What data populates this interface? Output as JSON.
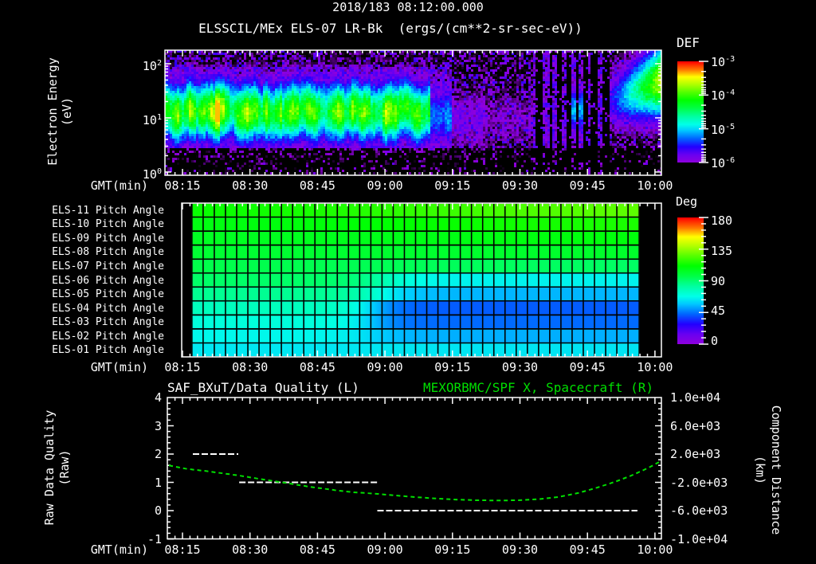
{
  "header": {
    "datetime": "2018/183 08:12:00.000",
    "instrument_title": "ELSSCIL/MEx ELS-07 LR-Bk  (ergs/(cm**2-sr-sec-eV))"
  },
  "time_axis": {
    "label": "GMT(min)",
    "tick_labels": [
      "08:15",
      "08:30",
      "08:45",
      "09:00",
      "09:15",
      "09:30",
      "09:45",
      "10:00"
    ],
    "start_time": "08:12",
    "minutes_per_major_tick": 15,
    "minor_ticks_per_major": 9
  },
  "colors": {
    "background": "#000000",
    "foreground": "#ffffff",
    "series_green": "#00df00",
    "rainbow_stops": [
      [
        0.0,
        "#9000dc"
      ],
      [
        0.08,
        "#6a00f0"
      ],
      [
        0.16,
        "#2200ff"
      ],
      [
        0.24,
        "#0064ff"
      ],
      [
        0.32,
        "#00c8ff"
      ],
      [
        0.38,
        "#00ffe8"
      ],
      [
        0.46,
        "#00ffa0"
      ],
      [
        0.54,
        "#00ff46"
      ],
      [
        0.62,
        "#00ff00"
      ],
      [
        0.7,
        "#55ff00"
      ],
      [
        0.78,
        "#b4ff00"
      ],
      [
        0.85,
        "#ffff00"
      ],
      [
        0.92,
        "#ff7800"
      ],
      [
        1.0,
        "#ff0000"
      ]
    ]
  },
  "panels": {
    "spectrogram": {
      "ylabel_line1": "Electron Energy",
      "ylabel_line2": "(eV)",
      "y_tick_exponents": [
        2,
        1,
        0
      ],
      "colorbar_title": "DEF",
      "colorbar_tick_exponents": [
        -3,
        -4,
        -5,
        -6
      ]
    },
    "pitch": {
      "colorbar_title": "Deg",
      "colorbar_ticks": [
        "180",
        "135",
        "90",
        "45",
        "0"
      ]
    },
    "quality": {
      "title_left": "SAF_BXuT/Data Quality (L)",
      "title_right": "MEXORBMC/SPF X, Spacecraft (R)",
      "ylabel_line1": "Raw Data Quality",
      "ylabel_line2": "(Raw)",
      "ylabel_right_line1": "Component Distance",
      "ylabel_right_line2": "(km)",
      "y_left_ticks": [
        "4",
        "3",
        "2",
        "1",
        "0",
        "-1"
      ],
      "y_right_ticks": [
        "1.0e+04",
        "6.0e+03",
        "2.0e+03",
        "-2.0e+03",
        "-6.0e+03",
        "-1.0e+04"
      ]
    }
  },
  "chart_data": [
    {
      "type": "heatmap",
      "name": "electron_energy_spectrogram",
      "title": "ELSSCIL/MEx ELS-07 LR-Bk (ergs/(cm**2-sr-sec-eV))",
      "start": "2018/183 08:12:00.000",
      "xlabel": "GMT(min)",
      "x_ticks": [
        "08:15",
        "08:30",
        "08:45",
        "09:00",
        "09:15",
        "09:30",
        "09:45",
        "10:00"
      ],
      "ylabel": "Electron Energy (eV)",
      "y_scale": "log",
      "y_range_ev": [
        0.9,
        178
      ],
      "colorbar": {
        "title": "DEF",
        "units": "ergs/(cm**2-sr-sec-eV)",
        "log10_range": [
          -6,
          -3
        ]
      },
      "features": [
        {
          "name": "background_speckle",
          "log10_flux_range": [
            -6.5,
            -5.55
          ]
        },
        {
          "name": "enhanced_striated_band",
          "t_min": [
            0,
            58
          ],
          "log10_e_center": 1.02,
          "log10_e_sigma": 0.38,
          "peak_log10_flux": -3.9,
          "brighter_before_min": 25
        },
        {
          "name": "weakening_band",
          "t_min": [
            58,
            63
          ],
          "peak_log10_flux": -4.9
        },
        {
          "name": "faint_interval",
          "t_min": [
            63,
            81
          ],
          "peak_log10_flux": -5.6,
          "log10_e_center": 0.95
        },
        {
          "name": "dropout_interval",
          "t_min": [
            81,
            98
          ],
          "dropout_fraction": 0.55,
          "cyan_patch": {
            "t_min": [
              89,
              93
            ],
            "log10_e_center": 1.15,
            "peak_log10_flux": -5.1
          }
        },
        {
          "name": "recovery_blob",
          "t_min": [
            98,
            110.5
          ],
          "log10_e_center_start": 1.3,
          "log10_e_center_end": 1.72,
          "peak_log10_flux_end": -3.4
        }
      ]
    },
    {
      "type": "heatmap",
      "name": "pitch_angles",
      "units": "deg",
      "data_window": {
        "start": "08:17",
        "end": "09:56",
        "start_min": 5.1,
        "end_min": 104.5
      },
      "grid_columns": 40,
      "colorbar": {
        "title": "Deg",
        "range": [
          0,
          180
        ]
      },
      "rows": [
        {
          "label": "ELS-11 Pitch Angle",
          "deg_start": 111,
          "deg_end": 129,
          "transition_center_min": 55,
          "transition_width_min": 90
        },
        {
          "label": "ELS-10 Pitch Angle",
          "deg_start": 107,
          "deg_end": 117,
          "transition_center_min": 55,
          "transition_width_min": 90
        },
        {
          "label": "ELS-09 Pitch Angle",
          "deg_start": 104,
          "deg_end": 110,
          "transition_center_min": 55,
          "transition_width_min": 90
        },
        {
          "label": "ELS-08 Pitch Angle",
          "deg_start": 101,
          "deg_end": 103,
          "transition_center_min": 55,
          "transition_width_min": 90
        },
        {
          "label": "ELS-07 Pitch Angle",
          "deg_start": 97,
          "deg_end": 92,
          "transition_center_min": 55,
          "transition_width_min": 90
        },
        {
          "label": "ELS-06 Pitch Angle",
          "deg_start": 92,
          "deg_end": 66,
          "transition_center_min": 48,
          "transition_width_min": 14
        },
        {
          "label": "ELS-05 Pitch Angle",
          "deg_start": 85,
          "deg_end": 55,
          "transition_center_min": 47,
          "transition_width_min": 13
        },
        {
          "label": "ELS-04 Pitch Angle",
          "deg_start": 77,
          "deg_end": 42,
          "transition_center_min": 45,
          "transition_width_min": 12
        },
        {
          "label": "ELS-03 Pitch Angle",
          "deg_start": 71,
          "deg_end": 44,
          "transition_center_min": 45,
          "transition_width_min": 12
        },
        {
          "label": "ELS-02 Pitch Angle",
          "deg_start": 67,
          "deg_end": 54,
          "transition_center_min": 45,
          "transition_width_min": 13
        },
        {
          "label": "ELS-01 Pitch Angle",
          "deg_start": 64,
          "deg_end": 63,
          "transition_center_min": 55,
          "transition_width_min": 90
        }
      ]
    },
    {
      "type": "line",
      "name": "data_quality_and_spacecraft_x",
      "title_left": "SAF_BXuT/Data Quality (L)",
      "title_right": "MEXORBMC/SPF X, Spacecraft (R)",
      "ylabel_left": "Raw Data Quality (Raw)",
      "ylabel_right": "Component Distance (km)",
      "y_left_range": [
        -1,
        4
      ],
      "y_right_range": [
        -10000,
        10000
      ],
      "t_min_reference": "minutes after 08:12:00",
      "quality_segments": [
        {
          "t_start_min": 5.3,
          "t_end_min": 15.4,
          "quality": 2
        },
        {
          "t_start_min": 15.6,
          "t_end_min": 46.4,
          "quality": 1
        },
        {
          "t_start_min": 46.3,
          "t_end_min": 104.1,
          "quality": 0
        }
      ],
      "spacecraft_x_km": [
        {
          "t_min": 0,
          "km": 400
        },
        {
          "t_min": 4,
          "km": -100
        },
        {
          "t_min": 8.5,
          "km": -420
        },
        {
          "t_min": 15.6,
          "km": -1040
        },
        {
          "t_min": 20,
          "km": -1500
        },
        {
          "t_min": 25.7,
          "km": -2060
        },
        {
          "t_min": 31,
          "km": -2600
        },
        {
          "t_min": 36.8,
          "km": -3100
        },
        {
          "t_min": 41,
          "km": -3400
        },
        {
          "t_min": 46.4,
          "km": -3630
        },
        {
          "t_min": 52,
          "km": -3950
        },
        {
          "t_min": 58,
          "km": -4230
        },
        {
          "t_min": 63,
          "km": -4420
        },
        {
          "t_min": 68.7,
          "km": -4540
        },
        {
          "t_min": 73,
          "km": -4560
        },
        {
          "t_min": 77.6,
          "km": -4540
        },
        {
          "t_min": 82,
          "km": -4380
        },
        {
          "t_min": 86.4,
          "km": -4090
        },
        {
          "t_min": 91,
          "km": -3500
        },
        {
          "t_min": 95.2,
          "km": -2740
        },
        {
          "t_min": 99,
          "km": -1950
        },
        {
          "t_min": 102.3,
          "km": -1160
        },
        {
          "t_min": 105,
          "km": -400
        },
        {
          "t_min": 107,
          "km": 200
        },
        {
          "t_min": 108.9,
          "km": 870
        }
      ]
    }
  ]
}
